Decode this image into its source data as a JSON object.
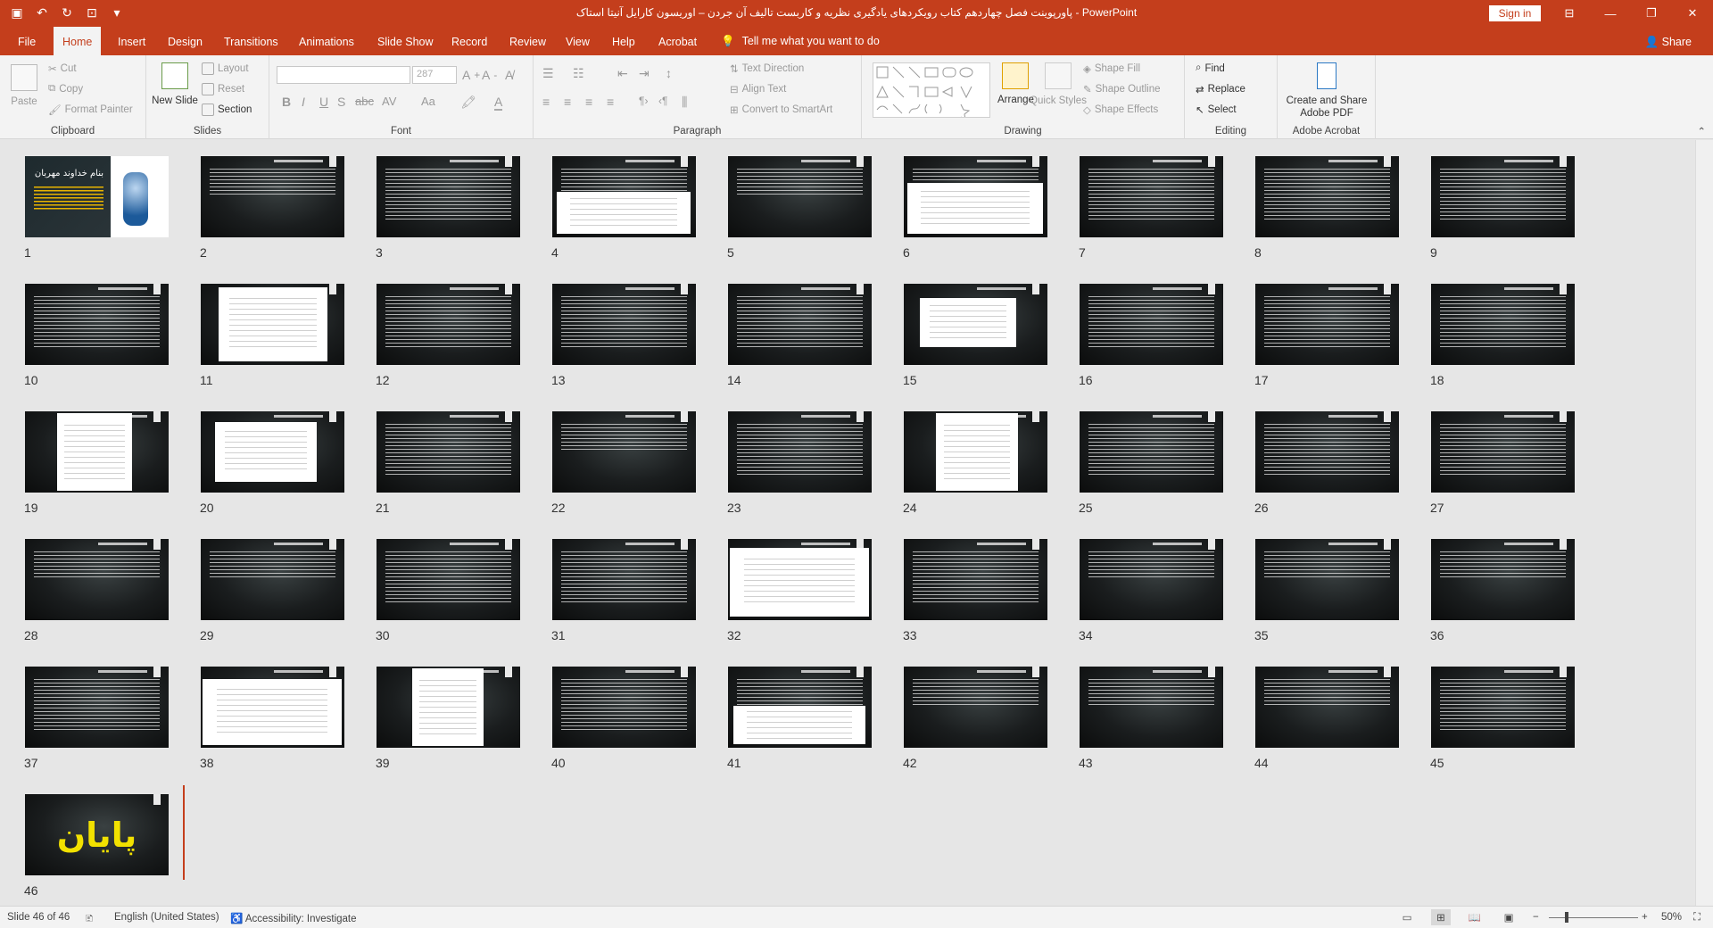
{
  "window": {
    "title": "پاورپوینت فصل چهاردهم کتاب رویکردهای یادگیری نظریه و کاربست تالیف آن جردن – اوریسون کارایل آنیتا استاک  -  PowerPoint",
    "sign_in": "Sign in"
  },
  "tabs": [
    "File",
    "Home",
    "Insert",
    "Design",
    "Transitions",
    "Animations",
    "Slide Show",
    "Record",
    "Review",
    "View",
    "Help",
    "Acrobat"
  ],
  "active_tab": "Home",
  "tell_me": "Tell me what you want to do",
  "share": "Share",
  "ribbon": {
    "clipboard": {
      "label": "Clipboard",
      "paste": "Paste",
      "cut": "Cut",
      "copy": "Copy",
      "format_painter": "Format Painter"
    },
    "slides": {
      "label": "Slides",
      "new_slide": "New Slide",
      "layout": "Layout",
      "reset": "Reset",
      "section": "Section"
    },
    "font": {
      "label": "Font",
      "size": "287"
    },
    "paragraph": {
      "label": "Paragraph",
      "text_direction": "Text Direction",
      "align_text": "Align Text",
      "convert_smartart": "Convert to SmartArt"
    },
    "drawing": {
      "label": "Drawing",
      "arrange": "Arrange",
      "quick_styles": "Quick Styles",
      "shape_fill": "Shape Fill",
      "shape_outline": "Shape Outline",
      "shape_effects": "Shape Effects"
    },
    "editing": {
      "label": "Editing",
      "find": "Find",
      "replace": "Replace",
      "select": "Select"
    },
    "acrobat": {
      "label": "Adobe Acrobat",
      "create_share": "Create and Share Adobe PDF"
    }
  },
  "slides": {
    "count": 46,
    "first_title": "بنام خداوند مهربان",
    "final_word": "پایان",
    "numbers": [
      "1",
      "2",
      "3",
      "4",
      "5",
      "6",
      "7",
      "8",
      "9",
      "10",
      "11",
      "12",
      "13",
      "14",
      "15",
      "16",
      "17",
      "18",
      "19",
      "20",
      "21",
      "22",
      "23",
      "24",
      "25",
      "26",
      "27",
      "28",
      "29",
      "30",
      "31",
      "32",
      "33",
      "34",
      "35",
      "36",
      "37",
      "38",
      "39",
      "40",
      "41",
      "42",
      "43",
      "44",
      "45",
      "46"
    ]
  },
  "status": {
    "slide_of": "Slide 46 of 46",
    "language": "English (United States)",
    "accessibility": "Accessibility: Investigate",
    "zoom": "50%"
  }
}
